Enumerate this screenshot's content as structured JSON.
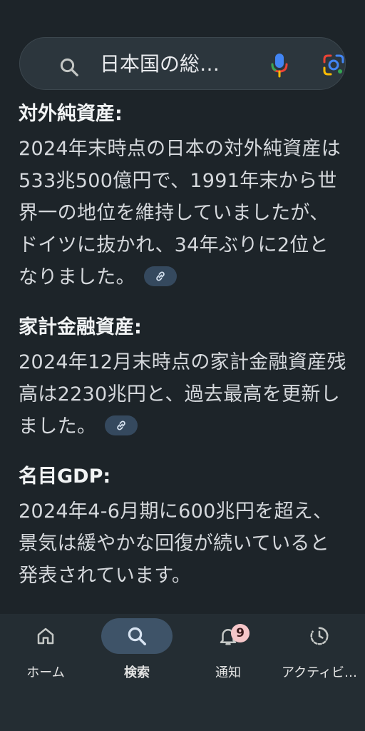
{
  "search": {
    "query": "日本国の総…"
  },
  "sections": [
    {
      "title": "対外純資産:",
      "body": "2024年末時点の日本の対外純資産は533兆500億円で、1991年末から世界一の地位を維持していましたが、ドイツに抜かれ、34年ぶりに2位となりました。",
      "has_link": true
    },
    {
      "title": "家計金融資産:",
      "body": "2024年12月末時点の家計金融資産残高は2230兆円と、過去最高を更新しました。",
      "has_link": true
    },
    {
      "title": "名目GDP:",
      "body": "2024年4-6月期に600兆円を超え、景気は緩やかな回復が続いていると発表されています。",
      "has_link": false
    }
  ],
  "bottom_nav": {
    "items": [
      {
        "label": "ホーム",
        "icon": "home-icon",
        "active": false
      },
      {
        "label": "検索",
        "icon": "search-icon",
        "active": true
      },
      {
        "label": "通知",
        "icon": "bell-icon",
        "active": false,
        "badge": "9"
      },
      {
        "label": "アクティビ…",
        "icon": "activity-icon",
        "active": false
      }
    ]
  },
  "colors": {
    "background": "#1d2429",
    "search_bar": "#2c363d",
    "active_pill": "#3e5368",
    "link_chip": "#35495e",
    "badge": "#f5c6c9"
  }
}
